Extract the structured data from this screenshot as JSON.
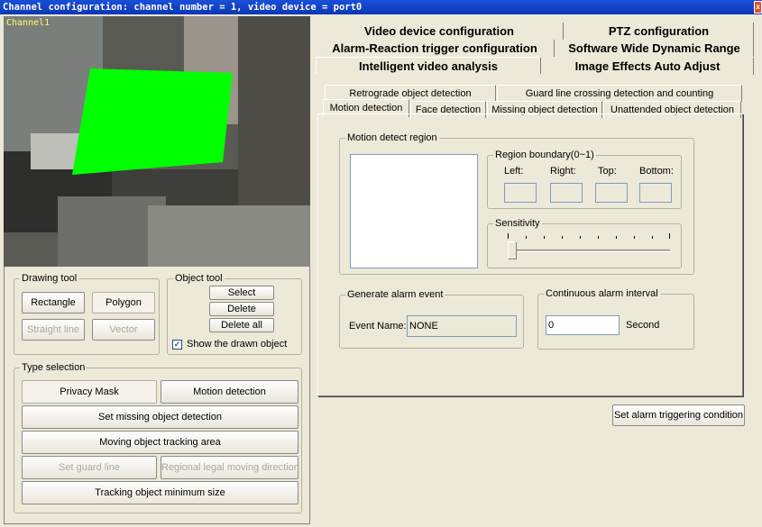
{
  "window": {
    "title": "Channel configuration: channel number = 1, video device = port0",
    "channel_label": "Channel1"
  },
  "top_tabs": {
    "row1": [
      "Video device configuration",
      "PTZ configuration"
    ],
    "row2": [
      "Alarm-Reaction trigger configuration",
      "Software Wide Dynamic Range"
    ],
    "row3": [
      "Intelligent video analysis",
      "Image Effects Auto Adjust"
    ]
  },
  "sub_tabs": {
    "row1": [
      "Retrograde object detection",
      "Guard line crossing detection and counting"
    ],
    "row2": [
      "Motion detection",
      "Face detection",
      "Missing object detection",
      "Unattended object detection"
    ]
  },
  "drawing_tool": {
    "label": "Drawing tool",
    "rectangle": "Rectangle",
    "polygon": "Polygon",
    "straight_line": "Straight line",
    "vector": "Vector"
  },
  "object_tool": {
    "label": "Object tool",
    "select": "Select",
    "delete": "Delete",
    "delete_all": "Delete all",
    "show_drawn": "Show the drawn object",
    "show_drawn_checked": true
  },
  "type_selection": {
    "label": "Type selection",
    "privacy_mask": "Privacy Mask",
    "motion_detection": "Motion detection",
    "set_missing": "Set missing object detection",
    "moving_tracking": "Moving object tracking area",
    "set_guard_line": "Set guard line",
    "regional_direction": "Regional legal moving direction",
    "tracking_min_size": "Tracking object minimum size"
  },
  "motion": {
    "region_label": "Motion detect region",
    "boundary_label": "Region boundary(0~1)",
    "left": "Left:",
    "right": "Right:",
    "top": "Top:",
    "bottom": "Bottom:",
    "sensitivity_label": "Sensitivity",
    "sensitivity_value": 0
  },
  "alarm": {
    "generate_label": "Generate alarm event",
    "event_name_label": "Event Name:",
    "event_name_value": "NONE",
    "interval_label": "Continuous alarm interval",
    "interval_value": "0",
    "interval_unit": "Second",
    "set_condition": "Set alarm triggering condition"
  },
  "colors": {
    "title_bar": "#0b37b4",
    "mask": "#00ff00",
    "window_bg": "#ece9d8"
  }
}
